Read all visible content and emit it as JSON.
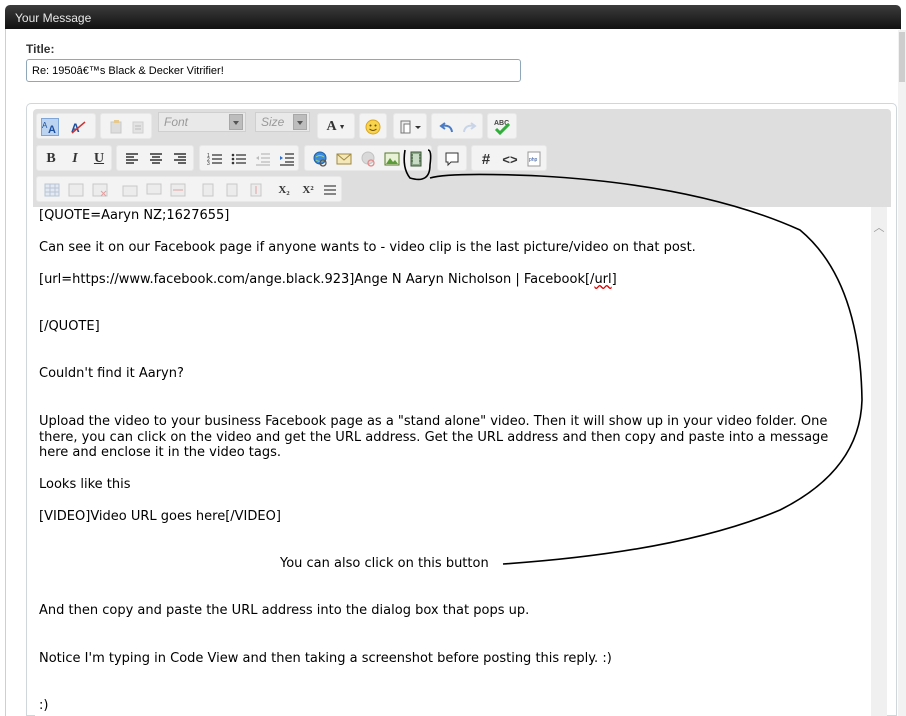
{
  "header": {
    "title": "Your Message"
  },
  "form": {
    "title_label": "Title:",
    "title_value": "Re: 1950â€™s Black & Decker Vitrifier!"
  },
  "toolbar": {
    "font_placeholder": "Font",
    "size_placeholder": "Size",
    "font_color_label": "A",
    "bold": "B",
    "italic": "I",
    "underline": "U",
    "hash": "#",
    "code": "<>",
    "subscript": "X₂",
    "superscript": "X²",
    "spellcheck": "ABC"
  },
  "editor": {
    "lines": {
      "l1": "[QUOTE=Aaryn NZ;1627655]",
      "l2": " Can see it on our Facebook page if anyone wants to - video clip is the last picture/video on that post.",
      "l3a": "[url=https://www.facebook.com/ange.black.923]Ange N Aaryn Nicholson | Facebook[/",
      "l3b": "url",
      "l3c": "]",
      "l4": "[/QUOTE]",
      "l5": "Couldn't find it Aaryn?",
      "l6": "Upload the video to your business Facebook page as a \"stand alone\" video.  Then it will show up in your video folder.  One",
      "l7": "there, you can click on the video and get the URL address.  Get the URL address and then copy and paste into a message",
      "l8": "here and enclose it in the video tags.",
      "l9": "Looks like this",
      "l10": "[VIDEO]Video URL goes here[/VIDEO]",
      "l11": "You can also click on this button",
      "l12": "And then copy and paste the URL address into the dialog box that pops up.",
      "l13": "Notice I'm typing in Code View and then taking a screenshot before posting this reply.  :)",
      "l14": ":)"
    }
  },
  "icons": [
    "source-view-icon",
    "remove-format-icon",
    "paste-icon",
    "paste-text-icon",
    "smiley-icon",
    "clipboard-icon",
    "undo-icon",
    "redo-icon",
    "spellcheck-icon",
    "align-left-icon",
    "align-center-icon",
    "align-right-icon",
    "ordered-list-icon",
    "unordered-list-icon",
    "outdent-icon",
    "indent-icon",
    "link-icon",
    "email-icon",
    "unlink-icon",
    "image-icon",
    "video-icon",
    "quote-icon",
    "hash-icon",
    "code-icon",
    "php-icon",
    "table-icon",
    "subscript-icon",
    "superscript-icon",
    "horizontal-rule-icon"
  ],
  "colors": {
    "header_bg": "#1a1a1a",
    "accent": "#3a7bd5",
    "annotation": "#000000"
  }
}
